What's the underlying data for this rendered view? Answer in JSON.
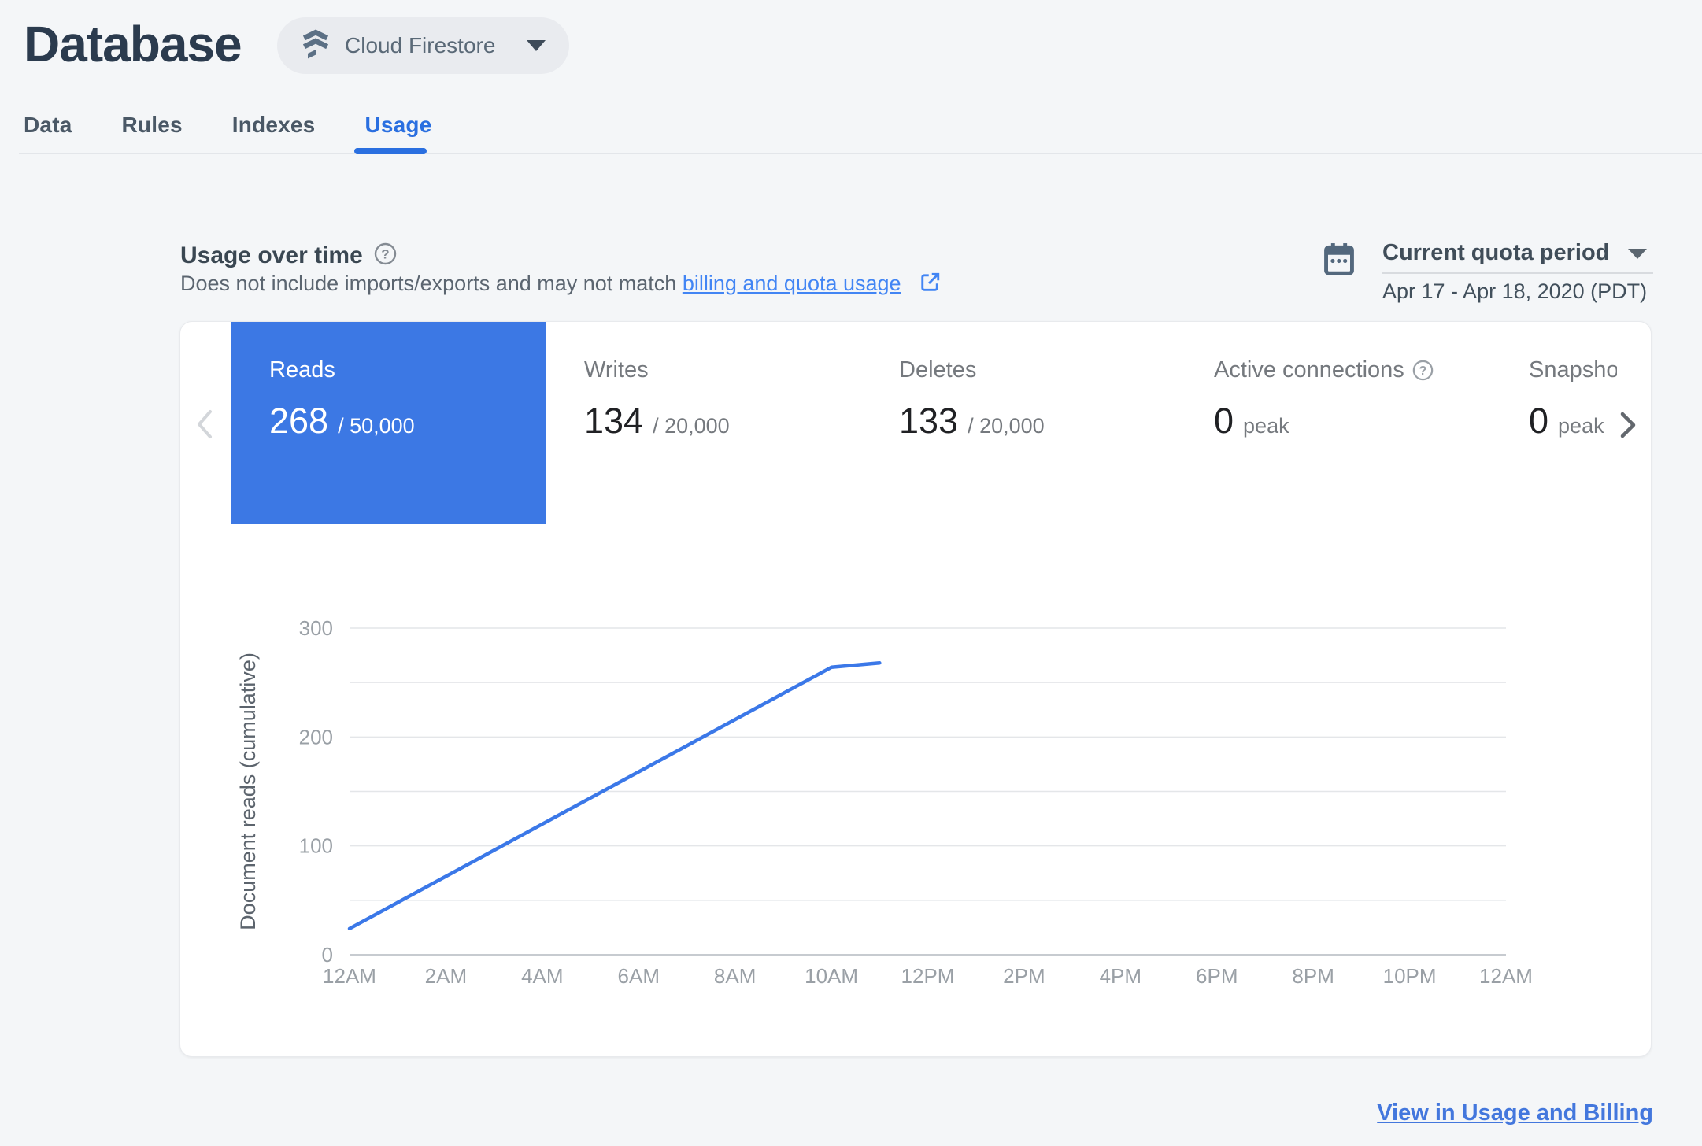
{
  "header": {
    "title": "Database",
    "product_selector": {
      "label": "Cloud Firestore",
      "icon": "firestore-icon"
    }
  },
  "tabs": [
    {
      "label": "Data",
      "active": false
    },
    {
      "label": "Rules",
      "active": false
    },
    {
      "label": "Indexes",
      "active": false
    },
    {
      "label": "Usage",
      "active": true
    }
  ],
  "usage_section": {
    "heading": "Usage over time",
    "heading_help_icon": "help-circle-icon",
    "subtitle_prefix": "Does not include imports/exports and may not match ",
    "subtitle_link": "billing and quota usage",
    "subtitle_link_icon": "open-in-new-icon",
    "period_selector": {
      "icon": "calendar-icon",
      "label": "Current quota period",
      "range": "Apr 17 - Apr 18, 2020 (PDT)"
    },
    "metrics": [
      {
        "label": "Reads",
        "value": "268",
        "suffix": "/ 50,000",
        "selected": true
      },
      {
        "label": "Writes",
        "value": "134",
        "suffix": "/ 20,000",
        "selected": false
      },
      {
        "label": "Deletes",
        "value": "133",
        "suffix": "/ 20,000",
        "selected": false
      },
      {
        "label": "Active connections",
        "value": "0",
        "suffix": "peak",
        "selected": false,
        "help": true
      },
      {
        "label": "Snapshot",
        "value": "0",
        "suffix": "peak",
        "selected": false,
        "truncated": true
      }
    ],
    "pager": {
      "prev_icon": "chevron-left-icon",
      "next_icon": "chevron-right-icon"
    },
    "footer_link": "View in Usage and Billing"
  },
  "chart_data": {
    "type": "line",
    "title": "",
    "xlabel": "",
    "ylabel": "Document reads (cumulative)",
    "ylim": [
      0,
      300
    ],
    "y_grid_step": 50,
    "y_tick_labels": [
      0,
      100,
      200,
      300
    ],
    "x_range_hours": [
      0,
      24
    ],
    "x_tick_hours": [
      0,
      2,
      4,
      6,
      8,
      10,
      12,
      14,
      16,
      18,
      20,
      22,
      24
    ],
    "x_tick_labels": [
      "12AM",
      "2AM",
      "4AM",
      "6AM",
      "8AM",
      "10AM",
      "12PM",
      "2PM",
      "4PM",
      "6PM",
      "8PM",
      "10PM",
      "12AM"
    ],
    "grid": true,
    "legend": "none",
    "series": [
      {
        "name": "Document reads (cumulative)",
        "color": "#3b78e8",
        "points": [
          {
            "hour": 0,
            "value": 24
          },
          {
            "hour": 10,
            "value": 264
          },
          {
            "hour": 11,
            "value": 268
          }
        ]
      }
    ]
  },
  "colors": {
    "page_background": "#f4f6f8",
    "selected_tile": "#3c78e4",
    "chart_line": "#3b78e8",
    "link_blue": "#4285f4",
    "active_tab": "#2a6fe0",
    "footer_link": "#4377dd"
  }
}
